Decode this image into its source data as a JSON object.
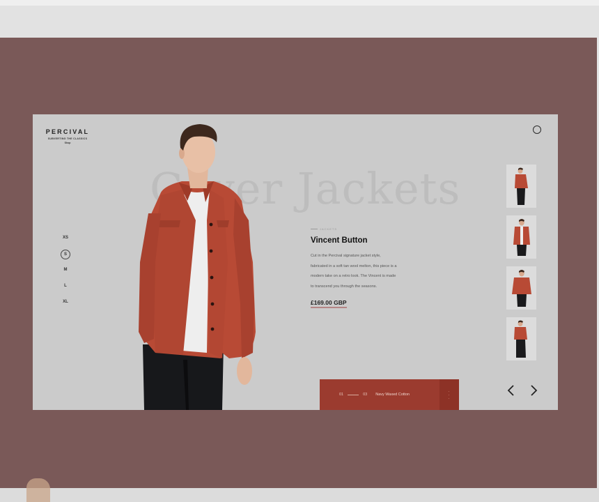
{
  "brand": {
    "name": "PERCIVAL",
    "tagline": "SUBVERTING THE CLASSICS",
    "sub": "Shop"
  },
  "hero": {
    "title": "Cover Jackets"
  },
  "sizes": [
    {
      "label": "XS",
      "selected": false
    },
    {
      "label": "S",
      "selected": true
    },
    {
      "label": "M",
      "selected": false
    },
    {
      "label": "L",
      "selected": false
    },
    {
      "label": "XL",
      "selected": false
    }
  ],
  "product": {
    "category": "JACKETS",
    "name": "Vincent Button",
    "description_lines": [
      "Cut in the Percival signature jacket style,",
      "fabricated in a soft tan wool melton, this piece is a",
      "modern take on a retro look. The Vincent is made",
      "to transcend you through the seasons."
    ],
    "price": "£169.00 GBP"
  },
  "footer": {
    "current": "01",
    "total": "03",
    "label": "Navy Waxed Cotton"
  },
  "icons": {
    "search": "search-icon",
    "prev": "chevron-left-icon",
    "next": "chevron-right-icon",
    "more": "more-vertical-icon"
  },
  "colors": {
    "backdrop": "#7a5958",
    "card": "#cbcbcb",
    "accent": "#9b3b2f",
    "jacket": "#b84a35"
  }
}
